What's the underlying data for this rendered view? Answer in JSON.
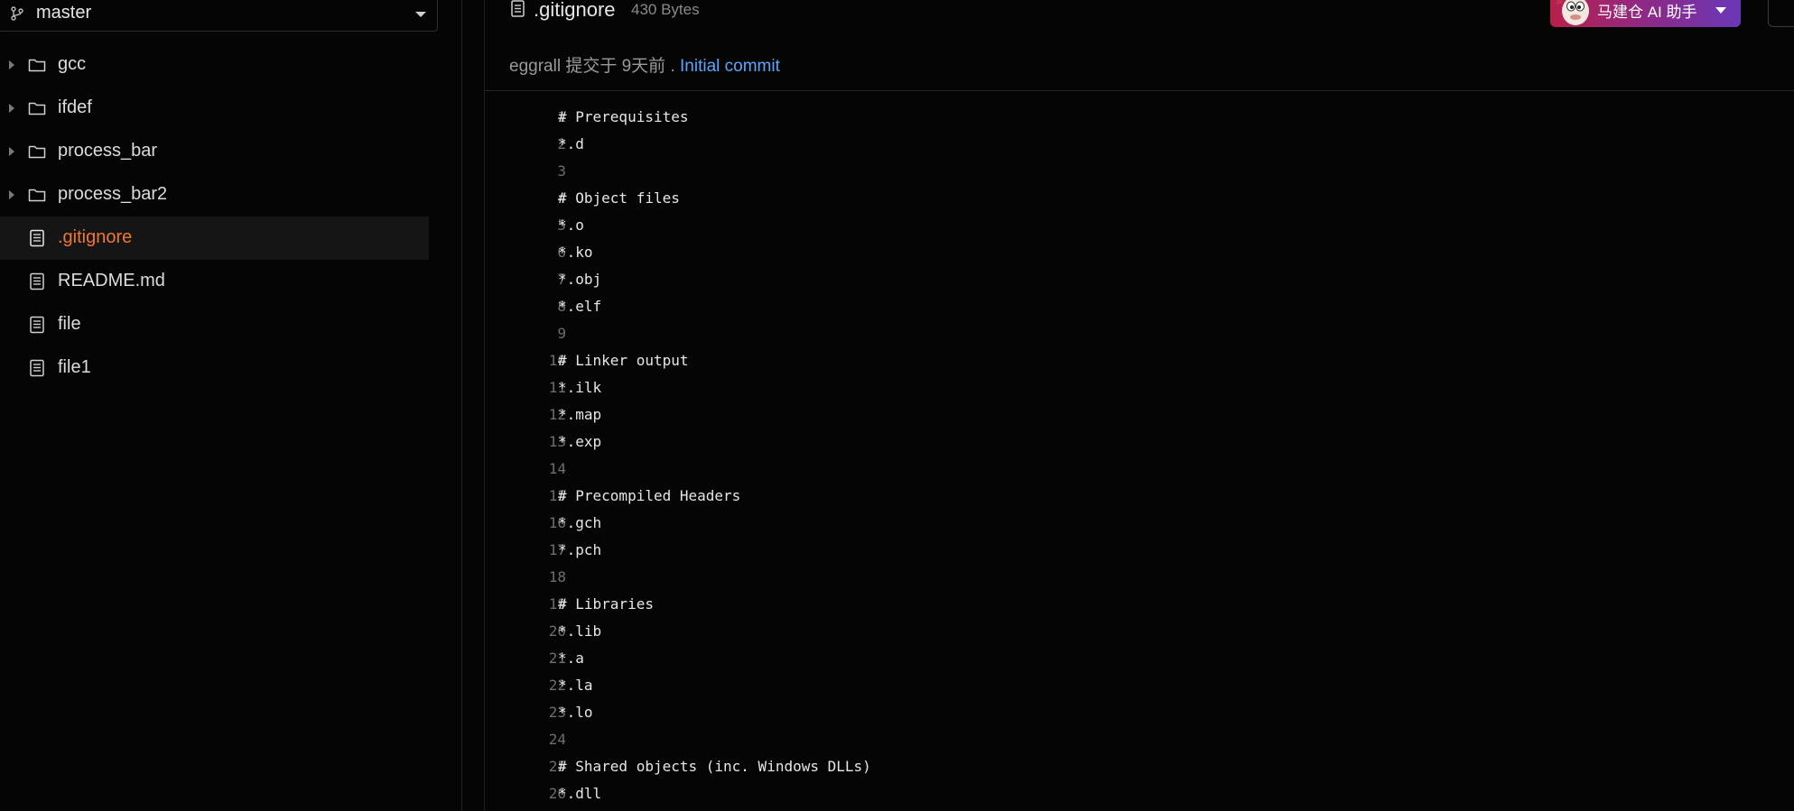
{
  "sidebar": {
    "branch": "master",
    "items": [
      {
        "type": "folder",
        "label": "gcc",
        "selected": false
      },
      {
        "type": "folder",
        "label": "ifdef",
        "selected": false
      },
      {
        "type": "folder",
        "label": "process_bar",
        "selected": false
      },
      {
        "type": "folder",
        "label": "process_bar2",
        "selected": false
      },
      {
        "type": "file",
        "label": ".gitignore",
        "selected": true
      },
      {
        "type": "file",
        "label": "README.md",
        "selected": false
      },
      {
        "type": "file",
        "label": "file",
        "selected": false
      },
      {
        "type": "file",
        "label": "file1",
        "selected": false
      }
    ]
  },
  "file": {
    "name": ".gitignore",
    "size": "430 Bytes",
    "commit_author_text": "eggrall 提交于 9天前 . ",
    "commit_message": "Initial commit"
  },
  "ai_assistant": {
    "label": "马建仓 AI 助手"
  },
  "code_lines": [
    {
      "n": "1",
      "text": "# Prerequisites"
    },
    {
      "n": "2",
      "text": "*.d"
    },
    {
      "n": "3",
      "text": ""
    },
    {
      "n": "4",
      "text": "# Object files"
    },
    {
      "n": "5",
      "text": "*.o"
    },
    {
      "n": "6",
      "text": "*.ko"
    },
    {
      "n": "7",
      "text": "*.obj"
    },
    {
      "n": "8",
      "text": "*.elf"
    },
    {
      "n": "9",
      "text": ""
    },
    {
      "n": "10",
      "text": "# Linker output"
    },
    {
      "n": "11",
      "text": "*.ilk"
    },
    {
      "n": "12",
      "text": "*.map"
    },
    {
      "n": "13",
      "text": "*.exp"
    },
    {
      "n": "14",
      "text": ""
    },
    {
      "n": "15",
      "text": "# Precompiled Headers"
    },
    {
      "n": "16",
      "text": "*.gch"
    },
    {
      "n": "17",
      "text": "*.pch"
    },
    {
      "n": "18",
      "text": ""
    },
    {
      "n": "19",
      "text": "# Libraries"
    },
    {
      "n": "20",
      "text": "*.lib"
    },
    {
      "n": "21",
      "text": "*.a"
    },
    {
      "n": "22",
      "text": "*.la"
    },
    {
      "n": "23",
      "text": "*.lo"
    },
    {
      "n": "24",
      "text": ""
    },
    {
      "n": "25",
      "text": "# Shared objects (inc. Windows DLLs)"
    },
    {
      "n": "26",
      "text": "*.dll"
    }
  ],
  "colors": {
    "selected_file": "#f0773a",
    "link": "#58a6ff",
    "background": "#050505"
  },
  "icons": {
    "branch": "git-branch-icon",
    "folder": "folder-icon",
    "file": "file-text-icon",
    "caret": "chevron-down-icon"
  }
}
